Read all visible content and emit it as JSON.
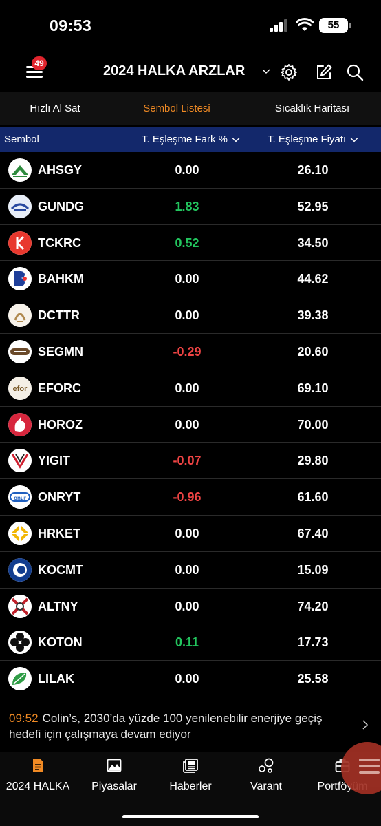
{
  "status_bar": {
    "time": "09:53",
    "battery": "55"
  },
  "header": {
    "menu_badge": "49",
    "title": "2024 HALKA ARZLAR"
  },
  "tabs": [
    {
      "label": "Hızlı Al Sat",
      "active": false
    },
    {
      "label": "Sembol Listesi",
      "active": true
    },
    {
      "label": "Sıcaklık Haritası",
      "active": false
    }
  ],
  "table": {
    "columns": [
      "Sembol",
      "T. Eşleşme Fark %",
      "T. Eşleşme Fiyatı"
    ],
    "rows": [
      {
        "symbol": "AHSGY",
        "diff": "0.00",
        "price": "26.10",
        "trend": "flat"
      },
      {
        "symbol": "GUNDG",
        "diff": "1.83",
        "price": "52.95",
        "trend": "up"
      },
      {
        "symbol": "TCKRC",
        "diff": "0.52",
        "price": "34.50",
        "trend": "up"
      },
      {
        "symbol": "BAHKM",
        "diff": "0.00",
        "price": "44.62",
        "trend": "flat"
      },
      {
        "symbol": "DCTTR",
        "diff": "0.00",
        "price": "39.38",
        "trend": "flat"
      },
      {
        "symbol": "SEGMN",
        "diff": "-0.29",
        "price": "20.60",
        "trend": "down"
      },
      {
        "symbol": "EFORC",
        "diff": "0.00",
        "price": "69.10",
        "trend": "flat"
      },
      {
        "symbol": "HOROZ",
        "diff": "0.00",
        "price": "70.00",
        "trend": "flat"
      },
      {
        "symbol": "YIGIT",
        "diff": "-0.07",
        "price": "29.80",
        "trend": "down"
      },
      {
        "symbol": "ONRYT",
        "diff": "-0.96",
        "price": "61.60",
        "trend": "down"
      },
      {
        "symbol": "HRKET",
        "diff": "0.00",
        "price": "67.40",
        "trend": "flat"
      },
      {
        "symbol": "KOCMT",
        "diff": "0.00",
        "price": "15.09",
        "trend": "flat"
      },
      {
        "symbol": "ALTNY",
        "diff": "0.00",
        "price": "74.20",
        "trend": "flat"
      },
      {
        "symbol": "KOTON",
        "diff": "0.11",
        "price": "17.73",
        "trend": "up"
      },
      {
        "symbol": "LILAK",
        "diff": "0.00",
        "price": "25.58",
        "trend": "flat"
      }
    ]
  },
  "news": {
    "time": "09:52",
    "text": "Colin’s, 2030’da yüzde 100 yenilenebilir enerjiye geçiş hedefi için çalışmaya devam ediyor"
  },
  "bottom_nav": [
    {
      "label": "2024 HALKA",
      "icon": "document-icon",
      "active": true
    },
    {
      "label": "Piyasalar",
      "icon": "chart-icon",
      "active": false
    },
    {
      "label": "Haberler",
      "icon": "newspaper-icon",
      "active": false
    },
    {
      "label": "Varant",
      "icon": "bubbles-icon",
      "active": false
    },
    {
      "label": "Portföyüm",
      "icon": "briefcase-icon",
      "active": false
    }
  ],
  "colors": {
    "up": "#22c55e",
    "down": "#ef4444",
    "flat": "#ffffff",
    "accent": "#f08a24",
    "column_header_bg": "#13286b"
  }
}
